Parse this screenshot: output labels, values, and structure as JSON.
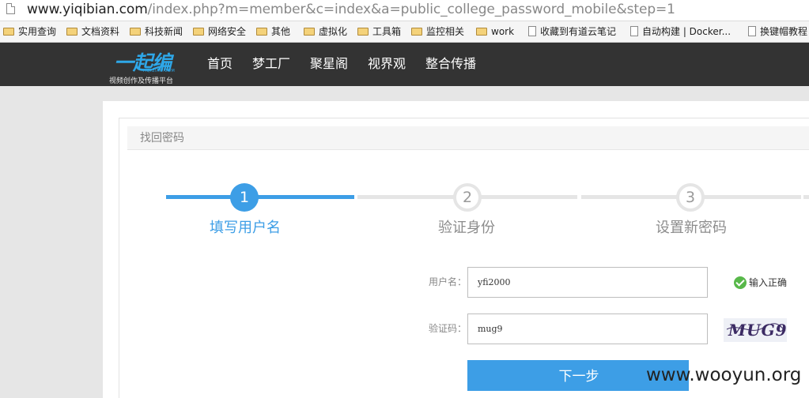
{
  "browser": {
    "url_host": "www.yiqibian.com",
    "url_path": "/index.php?m=member&c=index&a=public_college_password_mobile&step=1",
    "bookmarks": [
      {
        "label": "实用查询",
        "icon": "folder-icon"
      },
      {
        "label": "文档资料",
        "icon": "folder-icon"
      },
      {
        "label": "科技新闻",
        "icon": "folder-icon"
      },
      {
        "label": "网络安全",
        "icon": "folder-icon"
      },
      {
        "label": "其他",
        "icon": "folder-icon"
      },
      {
        "label": "虚拟化",
        "icon": "folder-icon"
      },
      {
        "label": "工具箱",
        "icon": "folder-icon"
      },
      {
        "label": "监控相关",
        "icon": "folder-icon"
      },
      {
        "label": "work",
        "icon": "folder-icon"
      },
      {
        "label": "收藏到有道云笔记",
        "icon": "page-icon"
      },
      {
        "label": "自动构建 | Docker...",
        "icon": "page-icon"
      },
      {
        "label": "换键帽教程",
        "icon": "page-icon"
      }
    ]
  },
  "site": {
    "logo_mark": "一起编",
    "logo_domain": "YIQIBIAN.COM",
    "logo_slogan": "视频创作及传播平台",
    "nav": [
      "首页",
      "梦工厂",
      "聚星阁",
      "视界观",
      "整合传播"
    ]
  },
  "panel": {
    "title": "找回密码"
  },
  "steps": [
    {
      "number": "1",
      "label": "填写用户名",
      "state": "active"
    },
    {
      "number": "2",
      "label": "验证身份",
      "state": "inactive"
    },
    {
      "number": "3",
      "label": "设置新密码",
      "state": "inactive"
    }
  ],
  "form": {
    "username_label": "用户名：",
    "username_value": "yfi2000",
    "username_status": "输入正确",
    "captcha_label": "验证码：",
    "captcha_value": "mug9",
    "captcha_image_text": "MUG9",
    "next_button": "下一步"
  },
  "watermark": "www.wooyun.org",
  "colors": {
    "accent": "#3d9ee6",
    "header_bg": "#333333",
    "success": "#58b84a"
  }
}
